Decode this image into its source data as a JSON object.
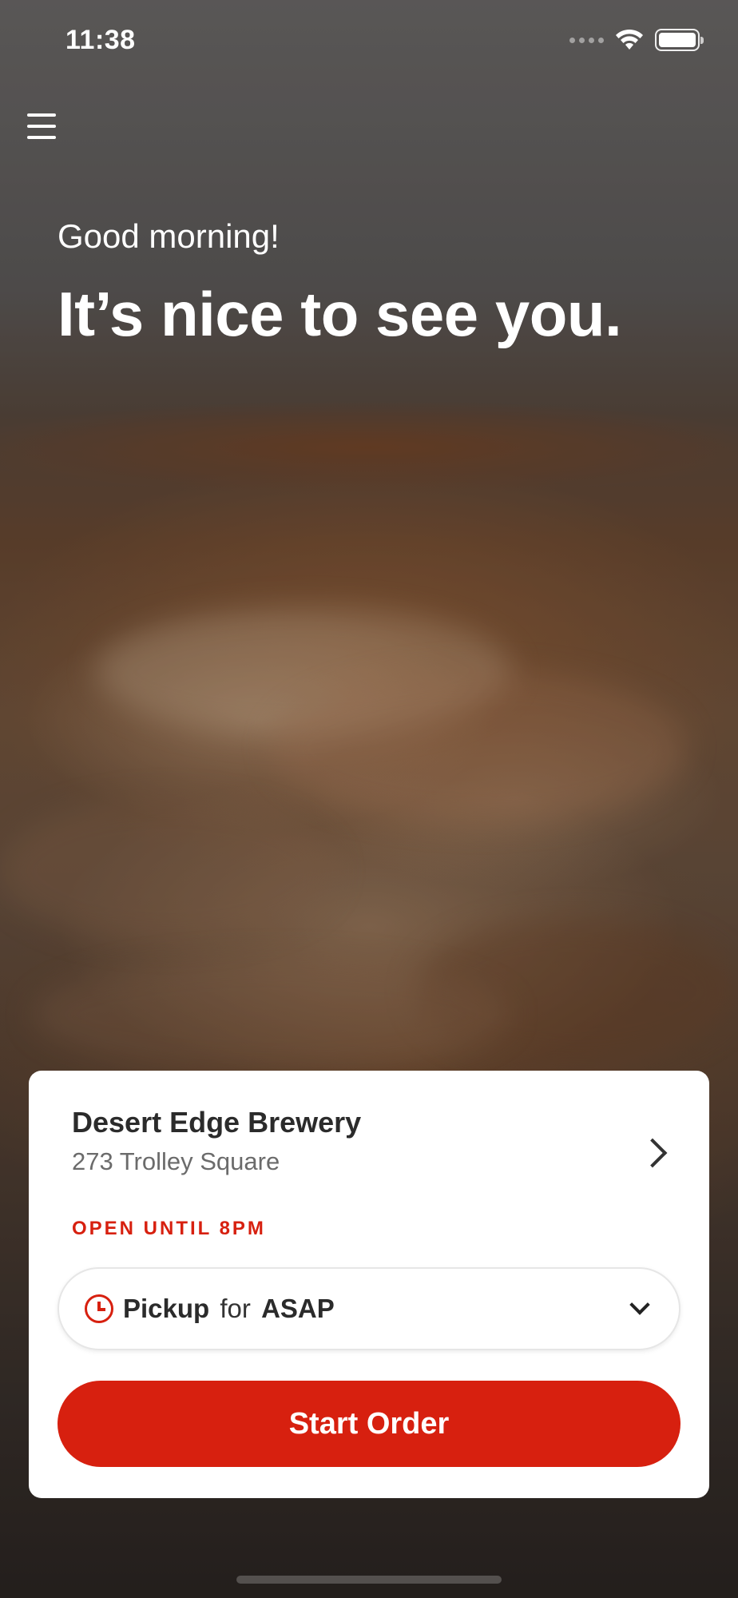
{
  "status_bar": {
    "time": "11:38"
  },
  "header": {
    "menu_icon": "hamburger-menu-icon",
    "greeting": "Good morning!",
    "headline": "It’s nice to see you."
  },
  "store": {
    "name": "Desert Edge Brewery",
    "address": "273 Trolley Square",
    "status": "OPEN UNTIL 8PM"
  },
  "order_type": {
    "mode": "Pickup",
    "connector": "for",
    "time": "ASAP"
  },
  "actions": {
    "start_order_label": "Start Order"
  },
  "colors": {
    "accent": "#d7200f",
    "card_bg": "#ffffff",
    "text_dark": "#2b2b2b",
    "text_muted": "#6b6b6b"
  }
}
